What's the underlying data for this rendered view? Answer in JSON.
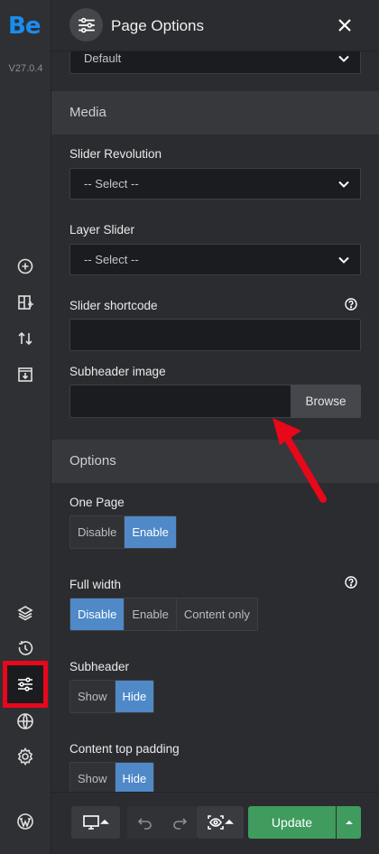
{
  "app": {
    "logo": "Be",
    "version": "V27.0.4"
  },
  "header": {
    "title": "Page Options"
  },
  "top_select": {
    "value": "Default"
  },
  "media": {
    "heading": "Media",
    "slider_revolution": {
      "label": "Slider Revolution",
      "value": "-- Select --"
    },
    "layer_slider": {
      "label": "Layer Slider",
      "value": "-- Select --"
    },
    "slider_shortcode": {
      "label": "Slider shortcode",
      "value": ""
    },
    "subheader_image": {
      "label": "Subheader image",
      "button": "Browse",
      "value": ""
    }
  },
  "options": {
    "heading": "Options",
    "one_page": {
      "label": "One Page",
      "options": [
        "Disable",
        "Enable"
      ],
      "selected": "Enable"
    },
    "full_width": {
      "label": "Full width",
      "options": [
        "Disable",
        "Enable",
        "Content only"
      ],
      "selected": "Disable"
    },
    "subheader": {
      "label": "Subheader",
      "options": [
        "Show",
        "Hide"
      ],
      "selected": "Hide"
    },
    "content_top_padding": {
      "label": "Content top padding",
      "options": [
        "Show",
        "Hide"
      ],
      "selected": "Hide"
    }
  },
  "toolbar": {
    "update_label": "Update"
  },
  "colors": {
    "accent_blue": "#4f89c8",
    "update_green": "#3f9b5e",
    "highlight_red": "#e8071b",
    "logo_blue": "#1a8cf0"
  },
  "icons": [
    "add-icon",
    "layout-add-icon",
    "sort-icon",
    "import-icon",
    "layers-icon",
    "history-icon",
    "sliders-icon",
    "globe-icon",
    "gear-icon",
    "wordpress-icon",
    "close-icon",
    "help-icon",
    "monitor-icon",
    "undo-icon",
    "redo-icon",
    "preview-icon"
  ]
}
